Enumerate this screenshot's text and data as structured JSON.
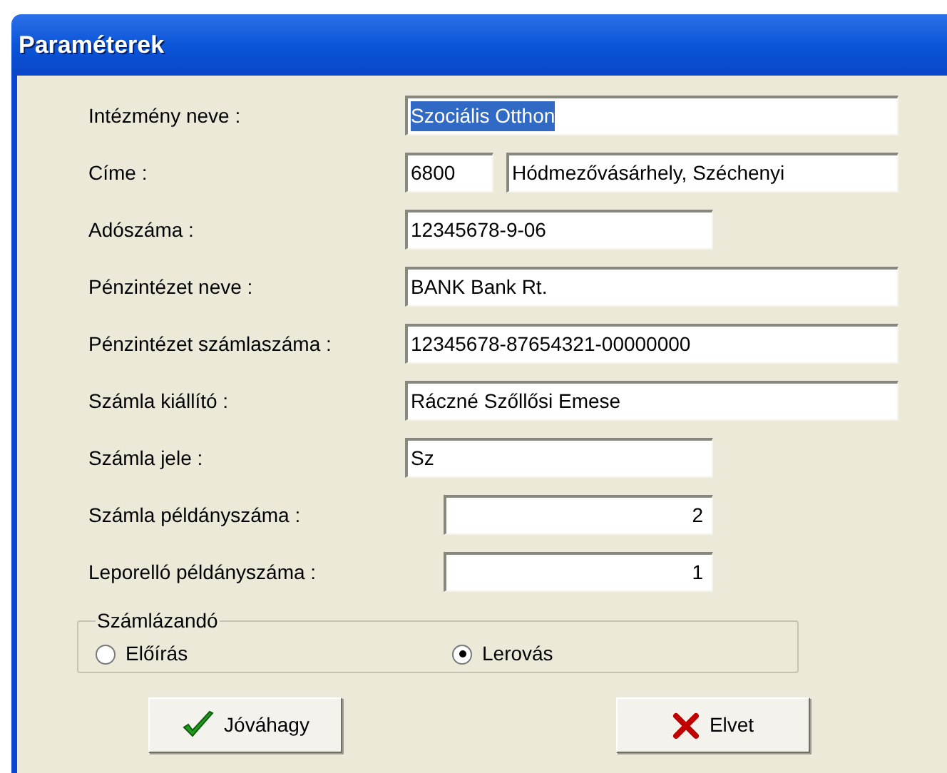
{
  "window": {
    "title": "Paraméterek"
  },
  "fields": [
    {
      "label": "Intézmény neve :",
      "inputs": [
        {
          "kind": "text",
          "value": "Szociális Otthon",
          "highlighted": true
        }
      ]
    },
    {
      "label": "Címe :",
      "inputs": [
        {
          "kind": "text",
          "value": "6800",
          "highlighted": false
        },
        {
          "kind": "text",
          "value": "Hódmezővásárhely, Széchenyi",
          "highlighted": false
        }
      ]
    },
    {
      "label": "Adószáma :",
      "inputs": [
        {
          "kind": "text",
          "value": "12345678-9-06",
          "highlighted": false
        }
      ]
    },
    {
      "label": "Pénzintézet neve :",
      "inputs": [
        {
          "kind": "text",
          "value": "BANK Bank Rt.",
          "highlighted": false
        }
      ]
    },
    {
      "label": "Pénzintézet számlaszáma :",
      "inputs": [
        {
          "kind": "text",
          "value": "12345678-87654321-00000000",
          "highlighted": false
        }
      ]
    },
    {
      "label": "Számla kiállító :",
      "inputs": [
        {
          "kind": "text",
          "value": "Ráczné Szőllősi Emese",
          "highlighted": false
        }
      ]
    },
    {
      "label": "Számla jele :",
      "inputs": [
        {
          "kind": "text",
          "value": "Sz",
          "highlighted": false
        }
      ]
    },
    {
      "label": "Számla példányszáma :",
      "inputs": [
        {
          "kind": "number",
          "value": "2",
          "highlighted": false
        }
      ]
    },
    {
      "label": "Leporelló példányszáma :",
      "inputs": [
        {
          "kind": "number",
          "value": "1",
          "highlighted": false
        }
      ]
    }
  ],
  "group": {
    "title": "Számlázandó",
    "options": [
      {
        "label": "Előírás",
        "selected": false
      },
      {
        "label": "Lerovás",
        "selected": true
      }
    ]
  },
  "buttons": [
    {
      "kind": "ok",
      "label": "Jóváhagy"
    },
    {
      "kind": "cancel",
      "label": "Elvet"
    }
  ]
}
